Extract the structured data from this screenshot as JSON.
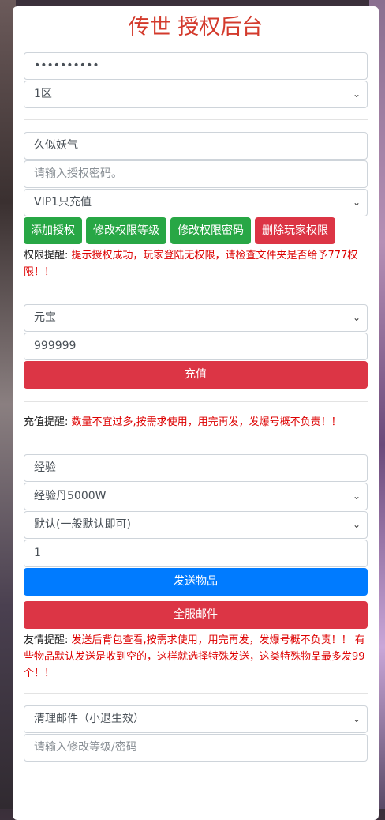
{
  "title": "传世 授权后台",
  "server_section": {
    "password_value": "••••••••••",
    "server_select": "1区"
  },
  "auth_section": {
    "player_name": "久似妖气",
    "auth_password_placeholder": "请输入授权密码。",
    "vip_select": "VIP1只充值",
    "buttons": {
      "add_auth": "添加授权",
      "modify_level": "修改权限等级",
      "modify_password": "修改权限密码",
      "delete_player": "删除玩家权限"
    },
    "tip_label": "权限提醒:",
    "tip_text": "提示授权成功，玩家登陆无权限，请检查文件夹是否给予777权限！！"
  },
  "recharge_section": {
    "currency_select": "元宝",
    "amount": "999999",
    "recharge_button": "充值",
    "tip_label": "充值提醒:",
    "tip_text": "数量不宜过多,按需求使用，用完再发，发爆号概不负责！！"
  },
  "item_section": {
    "category_value": "经验",
    "item_select": "经验丹5000W",
    "mode_select": "默认(一般默认即可)",
    "quantity": "1",
    "send_button": "发送物品",
    "mail_all_button": "全服邮件",
    "tip_label": "友情提醒:",
    "tip_text": "发送后背包查看,按需求使用，用完再发，发爆号概不负责！！ 有些物品默认发送是收到空的，这样就选择特殊发送，这类特殊物品最多发99个！！"
  },
  "mail_section": {
    "action_select": "清理邮件（小退生效）",
    "level_password_placeholder": "请输入修改等级/密码"
  },
  "colors": {
    "title": "#d33a2c",
    "green": "#28a745",
    "red": "#dc3545",
    "blue": "#007bff",
    "tip_text": "#dd0000"
  }
}
